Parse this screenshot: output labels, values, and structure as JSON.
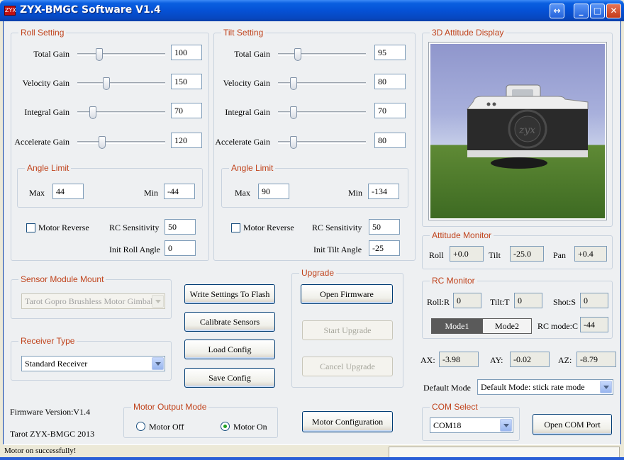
{
  "window": {
    "title": "ZYX-BMGC Software V1.4",
    "icon_text": "ZYX"
  },
  "roll": {
    "legend": "Roll Setting",
    "total_gain": {
      "label": "Total Gain",
      "value": "100",
      "slider": 0.23
    },
    "velocity_gain": {
      "label": "Velocity Gain",
      "value": "150",
      "slider": 0.32
    },
    "integral_gain": {
      "label": "Integral Gain",
      "value": "70",
      "slider": 0.15
    },
    "accelerate_gain": {
      "label": "Accelerate Gain",
      "value": "120",
      "slider": 0.26
    },
    "angle_limit": {
      "legend": "Angle Limit",
      "max_label": "Max",
      "max": "44",
      "min_label": "Min",
      "min": "-44"
    },
    "motor_reverse": "Motor Reverse",
    "rc_sensitivity_label": "RC Sensitivity",
    "rc_sensitivity": "50",
    "init_angle_label": "Init Roll Angle",
    "init_angle": "0"
  },
  "tilt": {
    "legend": "Tilt Setting",
    "total_gain": {
      "label": "Total Gain",
      "value": "95",
      "slider": 0.2
    },
    "velocity_gain": {
      "label": "Velocity Gain",
      "value": "80",
      "slider": 0.15
    },
    "integral_gain": {
      "label": "Integral Gain",
      "value": "70",
      "slider": 0.15
    },
    "accelerate_gain": {
      "label": "Accelerate Gain",
      "value": "80",
      "slider": 0.15
    },
    "angle_limit": {
      "legend": "Angle Limit",
      "max_label": "Max",
      "max": "90",
      "min_label": "Min",
      "min": "-134"
    },
    "motor_reverse": "Motor Reverse",
    "rc_sensitivity_label": "RC Sensitivity",
    "rc_sensitivity": "50",
    "init_angle_label": "Init Tilt Angle",
    "init_angle": "-25"
  },
  "display": {
    "legend": "3D Attitude Display"
  },
  "attitude": {
    "legend": "Attitude Monitor",
    "roll_label": "Roll",
    "roll": "+0.0",
    "tilt_label": "Tilt",
    "tilt": "-25.0",
    "pan_label": "Pan",
    "pan": "+0.4"
  },
  "rc_monitor": {
    "legend": "RC Monitor",
    "roll_label": "Roll:R",
    "roll": "0",
    "tilt_label": "Tilt:T",
    "tilt": "0",
    "shot_label": "Shot:S",
    "shot": "0",
    "mode1": "Mode1",
    "mode2": "Mode2",
    "rc_mode_label": "RC mode:C",
    "rc_mode": "-44"
  },
  "accel": {
    "ax_label": "AX:",
    "ax": "-3.98",
    "ay_label": "AY:",
    "ay": "-0.02",
    "az_label": "AZ:",
    "az": "-8.79"
  },
  "default_mode": {
    "label": "Default Mode",
    "value": "Default Mode: stick rate mode"
  },
  "sensor_mount": {
    "legend": "Sensor Module Mount",
    "value": "Tarot Gopro Brushless Motor Gimbal"
  },
  "receiver": {
    "legend": "Receiver Type",
    "value": "Standard Receiver"
  },
  "buttons": {
    "write_flash": "Write Settings To Flash",
    "calibrate": "Calibrate Sensors",
    "load_config": "Load Config",
    "save_config": "Save Config",
    "motor_config": "Motor Configuration",
    "open_com": "Open COM Port"
  },
  "upgrade": {
    "legend": "Upgrade",
    "open_firmware": "Open Firmware",
    "start": "Start Upgrade",
    "cancel": "Cancel Upgrade"
  },
  "motor_output": {
    "legend": "Motor Output Mode",
    "off": "Motor Off",
    "on": "Motor On"
  },
  "com": {
    "legend": "COM Select",
    "value": "COM18"
  },
  "footer": {
    "firmware": "Firmware Version:V1.4",
    "brand": "Tarot ZYX-BMGC 2013"
  },
  "status": {
    "message": "Motor on successfully!"
  },
  "colors": {
    "legend_text": "#c0431c",
    "title_bar": "#0551d5"
  }
}
